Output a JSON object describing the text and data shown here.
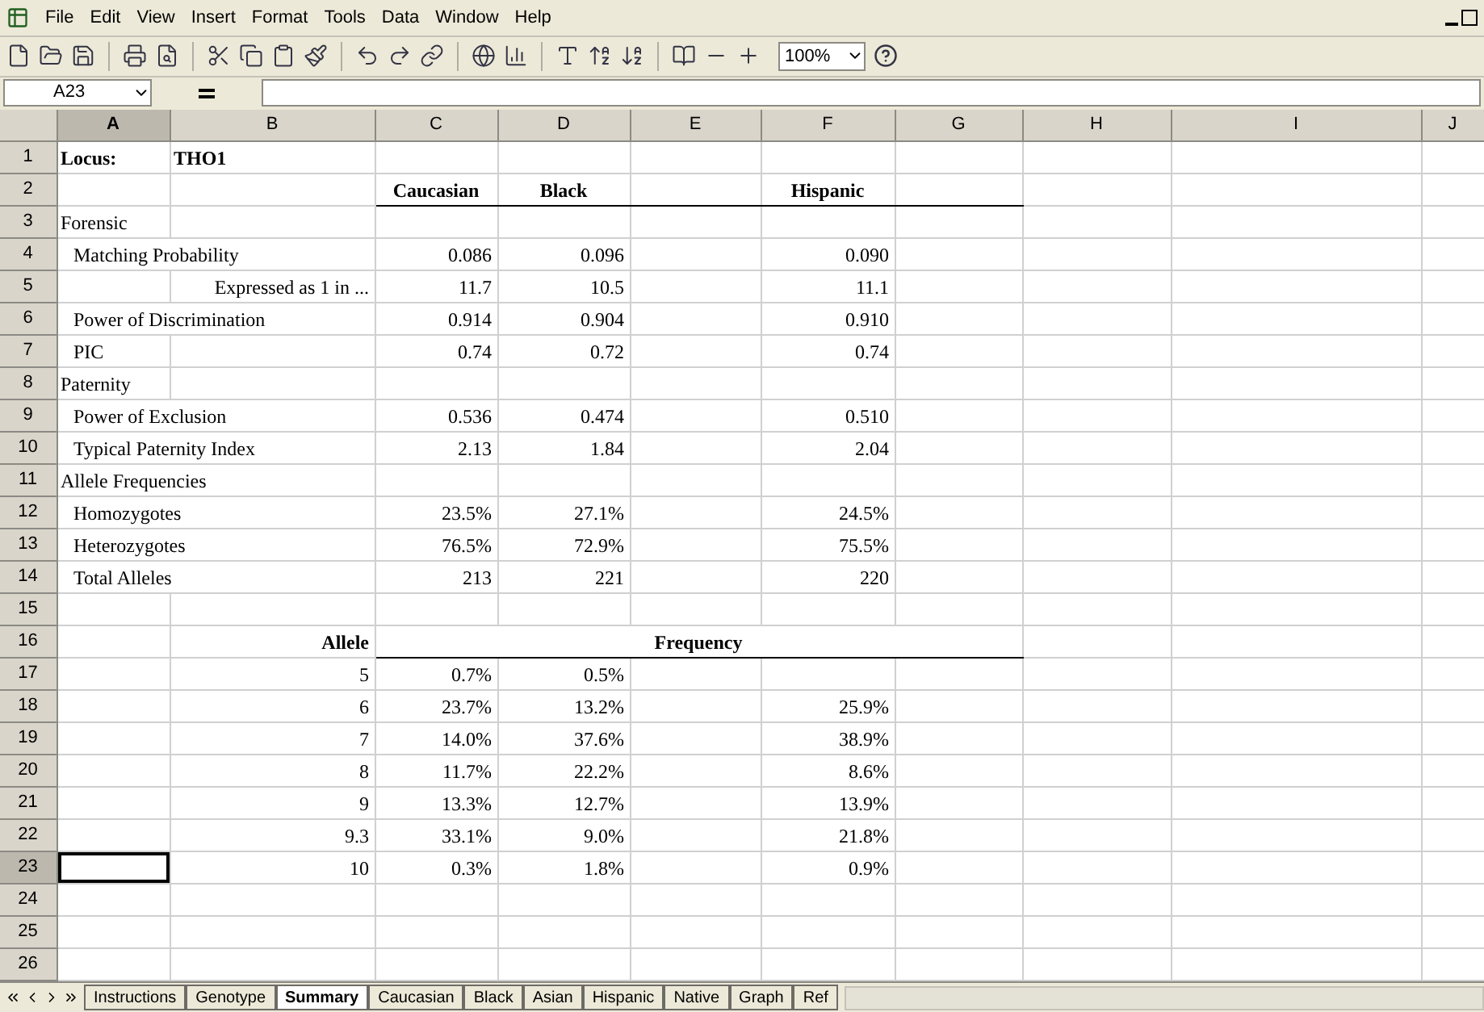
{
  "menu": [
    {
      "label": "File"
    },
    {
      "label": "Edit"
    },
    {
      "label": "View"
    },
    {
      "label": "Insert"
    },
    {
      "label": "Format"
    },
    {
      "label": "Tools"
    },
    {
      "label": "Data"
    },
    {
      "label": "Window"
    },
    {
      "label": "Help"
    }
  ],
  "toolbar": {
    "zoom": "100%"
  },
  "formula_bar": {
    "name_box": "A23"
  },
  "sheet": {
    "columns": [
      {
        "label": "A",
        "selected": true
      },
      {
        "label": "B",
        "selected": false
      },
      {
        "label": "C",
        "selected": false
      },
      {
        "label": "D",
        "selected": false
      },
      {
        "label": "E",
        "selected": false
      },
      {
        "label": "F",
        "selected": false
      },
      {
        "label": "G",
        "selected": false
      },
      {
        "label": "H",
        "selected": false
      },
      {
        "label": "I",
        "selected": false
      },
      {
        "label": "J",
        "selected": false
      }
    ],
    "rows": [
      {
        "n": "1",
        "kind": "title",
        "selected": false,
        "cells": [
          "Locus:",
          "THO1",
          null,
          null,
          null,
          null,
          null,
          null,
          null,
          null
        ]
      },
      {
        "n": "2",
        "kind": "header",
        "selected": false,
        "cells": [
          null,
          null,
          "Caucasian",
          "Black",
          null,
          "Hispanic",
          null,
          null,
          null,
          null
        ]
      },
      {
        "n": "3",
        "kind": "section",
        "selected": false,
        "cells": [
          "Forensic",
          null,
          null,
          null,
          null,
          null,
          null,
          null,
          null,
          null
        ]
      },
      {
        "n": "4",
        "kind": "metric",
        "selected": false,
        "cells": [
          {
            "text": "Matching Probability",
            "colspan": 2
          },
          "0.086",
          "0.096",
          null,
          "0.090",
          null,
          null,
          null,
          null
        ]
      },
      {
        "n": "5",
        "kind": "sub-metric",
        "selected": false,
        "cells": [
          null,
          "Expressed as 1 in ...",
          "11.7",
          "10.5",
          null,
          "11.1",
          null,
          null,
          null,
          null
        ]
      },
      {
        "n": "6",
        "kind": "metric",
        "selected": false,
        "cells": [
          {
            "text": "Power of Discrimination",
            "colspan": 2
          },
          "0.914",
          "0.904",
          null,
          "0.910",
          null,
          null,
          null,
          null
        ]
      },
      {
        "n": "7",
        "kind": "metric",
        "selected": false,
        "cells": [
          "PIC",
          null,
          "0.74",
          "0.72",
          null,
          "0.74",
          null,
          null,
          null,
          null
        ]
      },
      {
        "n": "8",
        "kind": "section",
        "selected": false,
        "cells": [
          "Paternity",
          null,
          null,
          null,
          null,
          null,
          null,
          null,
          null,
          null
        ]
      },
      {
        "n": "9",
        "kind": "metric",
        "selected": false,
        "cells": [
          {
            "text": "Power of Exclusion",
            "colspan": 2
          },
          "0.536",
          "0.474",
          null,
          "0.510",
          null,
          null,
          null,
          null
        ]
      },
      {
        "n": "10",
        "kind": "metric",
        "selected": false,
        "cells": [
          {
            "text": "Typical Paternity Index",
            "colspan": 2
          },
          "2.13",
          "1.84",
          null,
          "2.04",
          null,
          null,
          null,
          null
        ]
      },
      {
        "n": "11",
        "kind": "section",
        "selected": false,
        "cells": [
          {
            "text": "Allele Frequencies",
            "colspan": 2
          },
          null,
          null,
          null,
          null,
          null,
          null,
          null,
          null
        ]
      },
      {
        "n": "12",
        "kind": "metric",
        "selected": false,
        "cells": [
          {
            "text": "Homozygotes",
            "colspan": 2
          },
          "23.5%",
          "27.1%",
          null,
          "24.5%",
          null,
          null,
          null,
          null
        ]
      },
      {
        "n": "13",
        "kind": "metric",
        "selected": false,
        "cells": [
          {
            "text": "Heterozygotes",
            "colspan": 2
          },
          "76.5%",
          "72.9%",
          null,
          "75.5%",
          null,
          null,
          null,
          null
        ]
      },
      {
        "n": "14",
        "kind": "metric",
        "selected": false,
        "cells": [
          {
            "text": "Total Alleles",
            "colspan": 2
          },
          "213",
          "221",
          null,
          "220",
          null,
          null,
          null,
          null
        ]
      },
      {
        "n": "15",
        "kind": "blank",
        "selected": false,
        "cells": [
          null,
          null,
          null,
          null,
          null,
          null,
          null,
          null,
          null,
          null
        ]
      },
      {
        "n": "16",
        "kind": "allele-header",
        "selected": false,
        "cells": [
          null,
          "Allele",
          {
            "text": "Frequency",
            "colspan": 5
          },
          null,
          null,
          null
        ]
      },
      {
        "n": "17",
        "kind": "allele",
        "selected": false,
        "cells": [
          null,
          "5",
          "0.7%",
          "0.5%",
          null,
          null,
          null,
          null,
          null,
          null
        ]
      },
      {
        "n": "18",
        "kind": "allele",
        "selected": false,
        "cells": [
          null,
          "6",
          "23.7%",
          "13.2%",
          null,
          "25.9%",
          null,
          null,
          null,
          null
        ]
      },
      {
        "n": "19",
        "kind": "allele",
        "selected": false,
        "cells": [
          null,
          "7",
          "14.0%",
          "37.6%",
          null,
          "38.9%",
          null,
          null,
          null,
          null
        ]
      },
      {
        "n": "20",
        "kind": "allele",
        "selected": false,
        "cells": [
          null,
          "8",
          "11.7%",
          "22.2%",
          null,
          "8.6%",
          null,
          null,
          null,
          null
        ]
      },
      {
        "n": "21",
        "kind": "allele",
        "selected": false,
        "cells": [
          null,
          "9",
          "13.3%",
          "12.7%",
          null,
          "13.9%",
          null,
          null,
          null,
          null
        ]
      },
      {
        "n": "22",
        "kind": "allele",
        "selected": false,
        "cells": [
          null,
          "9.3",
          "33.1%",
          "9.0%",
          null,
          "21.8%",
          null,
          null,
          null,
          null
        ]
      },
      {
        "n": "23",
        "kind": "allele",
        "selected": true,
        "cells": [
          null,
          "10",
          "0.3%",
          "1.8%",
          null,
          "0.9%",
          null,
          null,
          null,
          null
        ]
      },
      {
        "n": "24",
        "kind": "blank",
        "selected": false,
        "cells": [
          null,
          null,
          null,
          null,
          null,
          null,
          null,
          null,
          null,
          null
        ]
      },
      {
        "n": "25",
        "kind": "blank",
        "selected": false,
        "cells": [
          null,
          null,
          null,
          null,
          null,
          null,
          null,
          null,
          null,
          null
        ]
      },
      {
        "n": "26",
        "kind": "blank",
        "selected": false,
        "cells": [
          null,
          null,
          null,
          null,
          null,
          null,
          null,
          null,
          null,
          null
        ]
      }
    ]
  },
  "sheet_tabs": [
    {
      "label": "Instructions",
      "selected": false
    },
    {
      "label": "Genotype",
      "selected": false
    },
    {
      "label": "Summary",
      "selected": true
    },
    {
      "label": "Caucasian",
      "selected": false
    },
    {
      "label": "Black",
      "selected": false
    },
    {
      "label": "Asian",
      "selected": false
    },
    {
      "label": "Hispanic",
      "selected": false
    },
    {
      "label": "Native",
      "selected": false
    },
    {
      "label": "Graph",
      "selected": false
    },
    {
      "label": "Ref",
      "selected": false
    }
  ]
}
